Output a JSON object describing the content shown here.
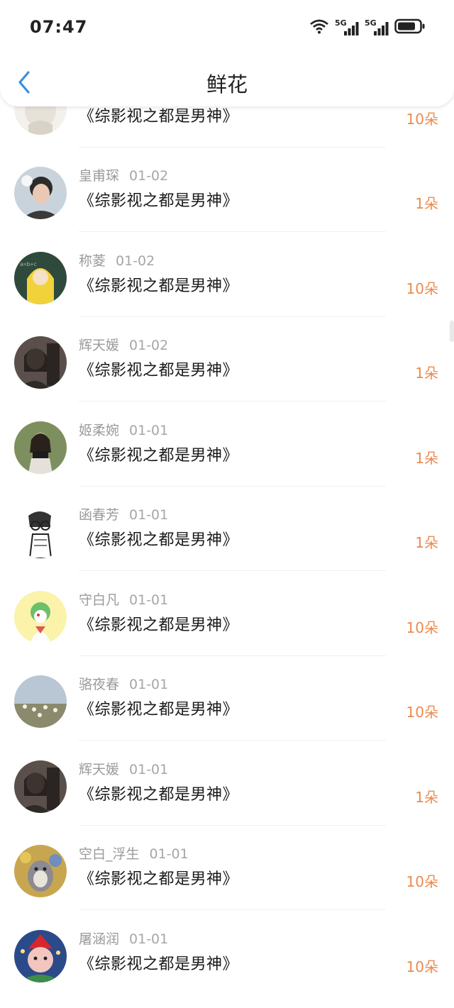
{
  "status_bar": {
    "time": "07:47",
    "net1": "5G",
    "net2": "5G"
  },
  "header": {
    "title": "鲜花"
  },
  "items": [
    {
      "name": "",
      "date": "",
      "title": "《综影视之都是男神》",
      "count": "10朵"
    },
    {
      "name": "皇甫琛",
      "date": "01-02",
      "title": "《综影视之都是男神》",
      "count": "1朵"
    },
    {
      "name": "称菱",
      "date": "01-02",
      "title": "《综影视之都是男神》",
      "count": "10朵"
    },
    {
      "name": "辉天媛",
      "date": "01-02",
      "title": "《综影视之都是男神》",
      "count": "1朵"
    },
    {
      "name": "姬柔婉",
      "date": "01-01",
      "title": "《综影视之都是男神》",
      "count": "1朵"
    },
    {
      "name": "函春芳",
      "date": "01-01",
      "title": "《综影视之都是男神》",
      "count": "1朵"
    },
    {
      "name": "守白凡",
      "date": "01-01",
      "title": "《综影视之都是男神》",
      "count": "10朵"
    },
    {
      "name": "骆夜春",
      "date": "01-01",
      "title": "《综影视之都是男神》",
      "count": "10朵"
    },
    {
      "name": "辉天媛",
      "date": "01-01",
      "title": "《综影视之都是男神》",
      "count": "1朵"
    },
    {
      "name": "空白_浮生",
      "date": "01-01",
      "title": "《综影视之都是男神》",
      "count": "10朵"
    },
    {
      "name": "屠涵润",
      "date": "01-01",
      "title": "《综影视之都是男神》",
      "count": "10朵"
    }
  ],
  "colors": {
    "accent": "#ec8a4e",
    "back_arrow": "#3d8fdc"
  }
}
